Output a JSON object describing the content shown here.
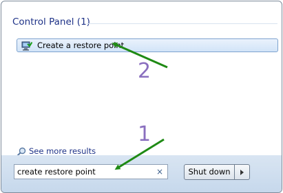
{
  "results": {
    "group_title": "Control Panel (1)",
    "items": [
      {
        "label": "Create a restore point",
        "icon": "system-restore-icon"
      }
    ],
    "see_more": "See more results"
  },
  "search": {
    "value": "create restore point",
    "clear_glyph": "×"
  },
  "power": {
    "shutdown_label": "Shut down"
  },
  "annotations": {
    "step_1": "1",
    "step_2": "2",
    "arrow_color": "#1f8a14",
    "number_color": "#8a6fbf"
  }
}
